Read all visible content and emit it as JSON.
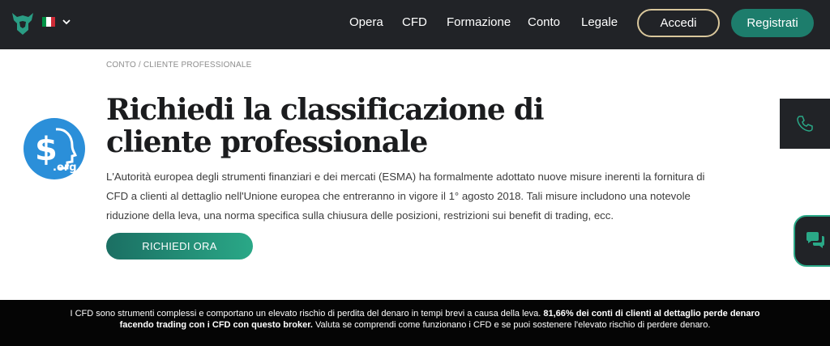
{
  "nav": {
    "items": [
      "Opera",
      "CFD",
      "Formazione",
      "Conto",
      "Legale"
    ],
    "login_label": "Accedi",
    "register_label": "Registrati"
  },
  "language": {
    "flag_colors": [
      "#009246",
      "#ffffff",
      "#ce2b37"
    ]
  },
  "breadcrumb": "CONTO / CLIENTE PROFESSIONALE",
  "badge": {
    "text": ".org"
  },
  "main": {
    "title": "Richiedi la classificazione di cliente professionale",
    "description": "L'Autorità europea degli strumenti finanziari e dei mercati (ESMA) ha formalmente adottato nuove misure inerenti la fornitura di CFD a clienti al dettaglio nell'Unione europea che entreranno in vigore il 1° agosto 2018. Tali misure includono una notevole riduzione della leva, una norma specifica sulla chiusura delle posizioni, restrizioni sui benefit di trading, ecc.",
    "cta_label": "RICHIEDI ORA"
  },
  "risk": {
    "part1": "I CFD sono strumenti complessi e comportano un elevato rischio di perdita del denaro in tempi brevi a causa della leva. ",
    "bold": "81,66% dei conti di clienti al dettaglio perde denaro facendo trading con i CFD con questo broker.",
    "part2": " Valuta se comprendi come funzionano i CFD e se puoi sostenere l'elevato rischio di perdere denaro."
  },
  "colors": {
    "header_bg": "#212327",
    "accent": "#1d7d6c",
    "login_border": "#d9c79c",
    "badge_bg": "#2b8fd9"
  },
  "icons": [
    "bull-logo-icon",
    "chevron-down-icon",
    "phone-icon",
    "chat-icon"
  ]
}
